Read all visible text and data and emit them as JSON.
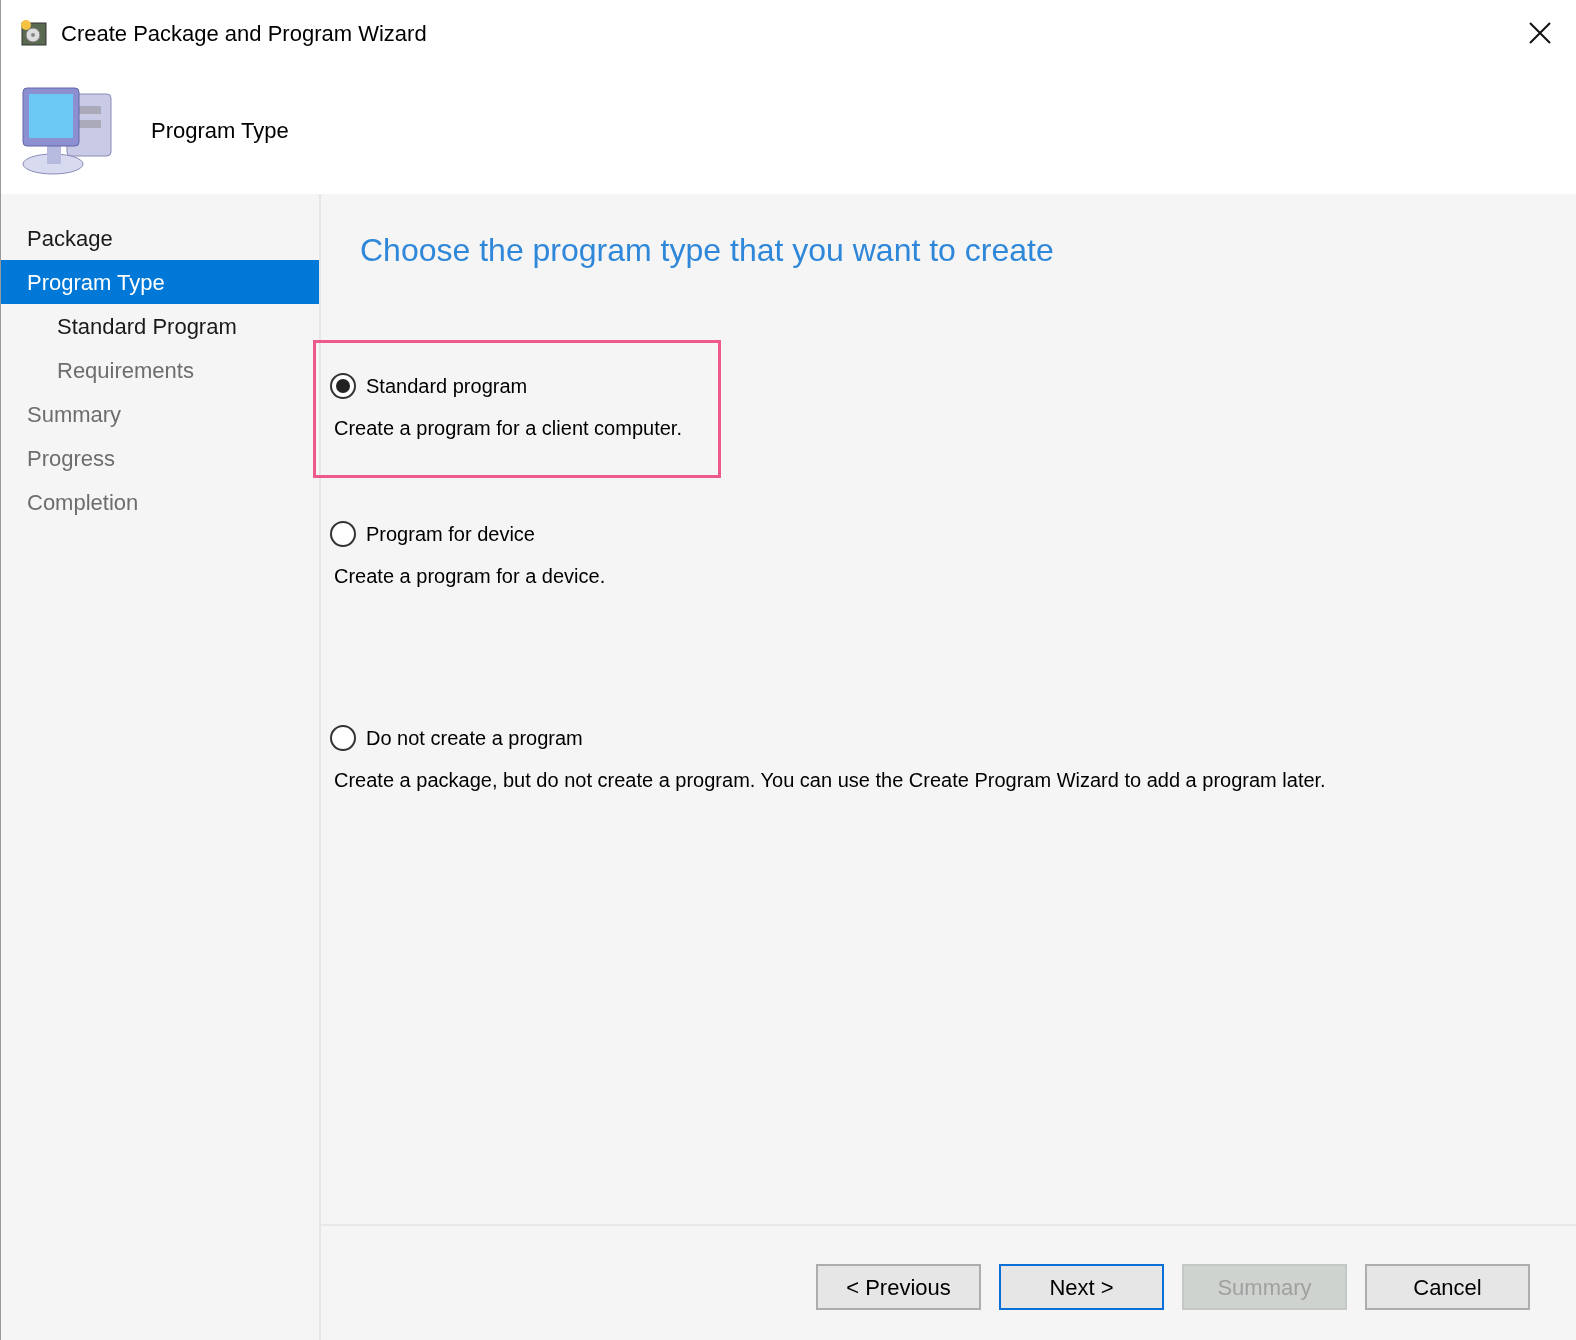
{
  "window": {
    "title": "Create Package and Program Wizard"
  },
  "header": {
    "title": "Program Type"
  },
  "sidebar": {
    "items": [
      {
        "label": "Package",
        "selected": false,
        "completed": true
      },
      {
        "label": "Program Type",
        "selected": true,
        "children": [
          {
            "label": "Standard Program",
            "selected": false,
            "completed": true
          },
          {
            "label": "Requirements",
            "selected": false,
            "completed": false
          }
        ]
      },
      {
        "label": "Summary",
        "selected": false,
        "completed": false
      },
      {
        "label": "Progress",
        "selected": false,
        "completed": false
      },
      {
        "label": "Completion",
        "selected": false,
        "completed": false
      }
    ]
  },
  "main": {
    "heading": "Choose the program type that you want to create",
    "options": [
      {
        "label": "Standard program",
        "description": "Create a program for a client computer.",
        "selected": true,
        "highlighted": true
      },
      {
        "label": "Program for device",
        "description": "Create a program for a device.",
        "selected": false,
        "highlighted": false
      },
      {
        "label": "Do not create a program",
        "description": "Create a package, but do not create a program. You can use the Create Program Wizard to add a program later.",
        "selected": false,
        "highlighted": false
      }
    ]
  },
  "buttons": [
    {
      "label": "< Previous",
      "default": false,
      "disabled": false
    },
    {
      "label": "Next >",
      "default": true,
      "disabled": false
    },
    {
      "label": "Summary",
      "default": false,
      "disabled": true
    },
    {
      "label": "Cancel",
      "default": false,
      "disabled": false
    }
  ]
}
